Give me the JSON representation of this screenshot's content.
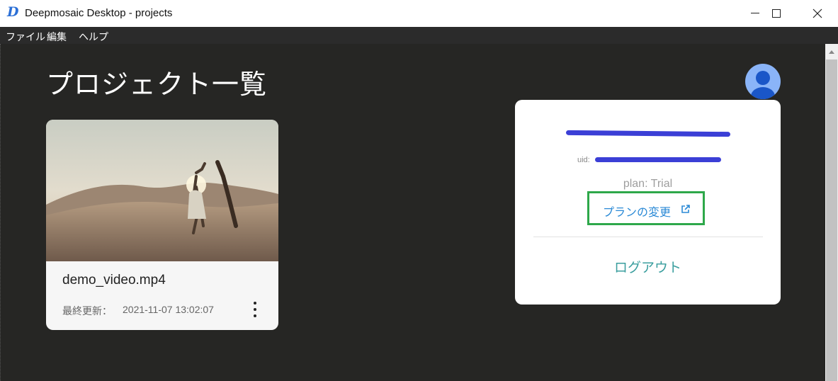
{
  "window": {
    "logo_letter": "D",
    "title": "Deepmosaic Desktop - projects"
  },
  "menu": [
    "ファイル",
    "編集",
    "ヘルプ"
  ],
  "page": {
    "title": "プロジェクト一覧"
  },
  "project_card": {
    "name": "demo_video.mp4",
    "updated_label": "最終更新：",
    "updated_value": "2021-11-07 13:02:07"
  },
  "account_popup": {
    "uid_label": "uid:",
    "plan": "plan: Trial",
    "change_plan_label": "プランの変更",
    "logout_label": "ログアウト"
  },
  "colors": {
    "background": "#262624",
    "link": "#2b8ad6",
    "logout": "#3a9e9e",
    "highlight_box": "#2ea84a",
    "redaction": "#3b3fd6"
  },
  "icons": [
    "app-logo-icon",
    "minimize-icon",
    "maximize-icon",
    "close-icon",
    "more-vert-icon",
    "avatar-icon",
    "external-link-icon",
    "scroll-up-icon"
  ]
}
